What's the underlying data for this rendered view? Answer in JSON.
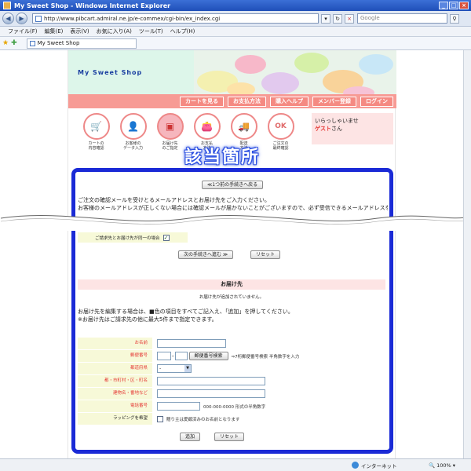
{
  "window": {
    "title": "My Sweet Shop - Windows Internet Explorer"
  },
  "toolbar": {
    "url": "http://www.pibcart.admiral.ne.jp/e-commex/cgi-bin/ex_index.cgi",
    "search_placeholder": "Google"
  },
  "menu": [
    "ファイル(F)",
    "編集(E)",
    "表示(V)",
    "お気に入り(A)",
    "ツール(T)",
    "ヘルプ(H)"
  ],
  "tab": {
    "label": "My Sweet Shop"
  },
  "shop": {
    "name": "My Sweet Shop",
    "nav": [
      "カートを見る",
      "お支払方法",
      "購入ヘルプ",
      "メンバー登録",
      "ログイン"
    ],
    "steps": [
      {
        "label": "カートの\n内容確認",
        "icon": "cart-icon"
      },
      {
        "label": "お客様の\nデータ入力",
        "icon": "person-icon"
      },
      {
        "label": "お届け先\nのご指定",
        "icon": "box-icon"
      },
      {
        "label": "お支払\n方法",
        "icon": "wallet-icon"
      },
      {
        "label": "配送\n方法",
        "icon": "truck-icon"
      },
      {
        "label": "ご注文の\n最終確認",
        "icon": "ok-icon"
      }
    ],
    "welcome": "いらっしゃいませ",
    "guest": "ゲスト",
    "guest_suffix": "さん"
  },
  "highlight": {
    "label": "該当箇所",
    "color": "#1a2ad6"
  },
  "content": {
    "back_button": "≪1つ前の手続きへ戻る",
    "intro_line1": "ご注文の確認メールを受けとるメールアドレスとお届け先をご入力ください。",
    "intro_line2": "お客様のメールアドレスが正しくない場合には確認メールが届かないことがございますので、必ず受信できるメールアドレスをご指定ください。",
    "same_address_label": "ご請求先とお届け先が同一の場合",
    "same_address_checked": true,
    "next_button": "次の手続きへ進む ≫",
    "reset_button": "リセット",
    "section_title": "お届け先",
    "no_address": "お届け先が追加されていません。",
    "instruction_line1": "お届け先を編集する場合は、■色の項目をすべてご記入え、「追加」を押してください。",
    "instruction_line2": "※お届け先はご請求先の他に最大5件まで指定できます。",
    "form": {
      "name_label": "お名前",
      "zip_label": "郵便番号",
      "zip_search_button": "郵便番号検索",
      "zip_note": "⇒7桁郵便番号検索 半角数字を入力",
      "pref_label": "都道府県",
      "pref_value": "-",
      "city_label": "都・市町村・区・町名",
      "street_label": "建物名・番地など",
      "phone_label": "電話番号",
      "phone_note": "000-000-0000 形式の半角数字",
      "wrap_label": "ラッピングを希望",
      "wrap_note": "贈り主は愛顧済みのお名前となります",
      "add_button": "追加",
      "reset_button": "リセット"
    }
  },
  "status": {
    "zone": "インターネット",
    "zoom": "100%"
  }
}
